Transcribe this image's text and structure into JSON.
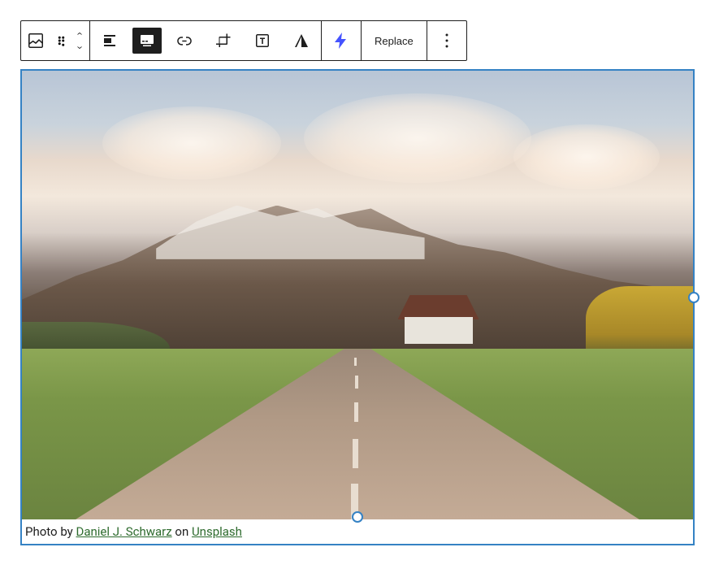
{
  "toolbar": {
    "replace_label": "Replace"
  },
  "caption": {
    "prefix": "Photo by ",
    "author": "Daniel J. Schwarz",
    "middle": " on ",
    "source": "Unsplash"
  }
}
